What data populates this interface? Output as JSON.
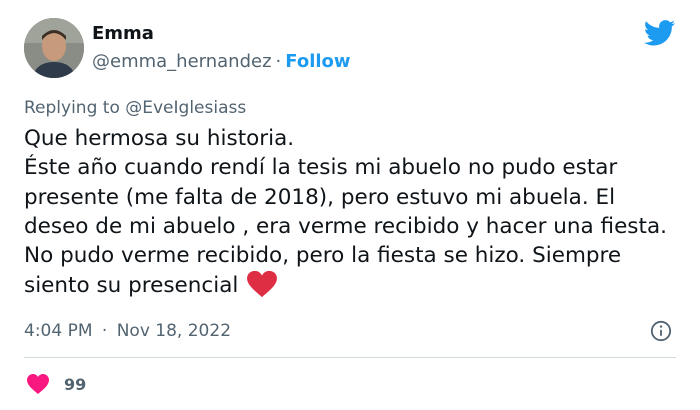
{
  "author": {
    "display_name": "Emma",
    "handle": "@emma_hernandez",
    "separator": "·",
    "follow_label": "Follow",
    "avatar": "profile-photo"
  },
  "reply": {
    "prefix": "Replying to",
    "handle": "@EveIglesiass"
  },
  "tweet": {
    "lines": [
      "Que hermosa su historia.",
      "Éste año cuando rendí la tesis mi abuelo no pudo estar presente (me falta de 2018), pero estuvo mi abuela. El deseo de mi abuelo , era verme recibido y hacer una fiesta. No pudo verme recibido, pero la fiesta se hizo. Siempre siento su presencial"
    ],
    "emoji": "red-heart-emoji"
  },
  "meta": {
    "time": "4:04 PM",
    "separator": "·",
    "date": "Nov 18, 2022"
  },
  "engagement": {
    "likes": "99"
  },
  "icons": {
    "brand": "twitter-bird-icon",
    "info": "info-icon",
    "like": "heart-icon"
  },
  "colors": {
    "accent": "#1d9bf0",
    "like": "#f91880",
    "text": "#0f1419",
    "secondary": "#536471"
  }
}
